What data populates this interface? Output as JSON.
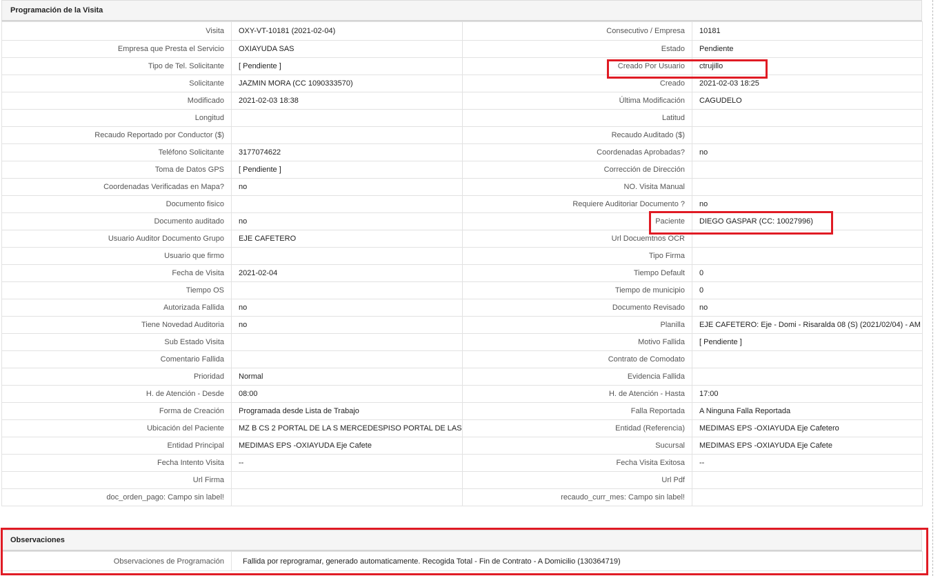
{
  "programacion": {
    "title": "Programación de la Visita",
    "rows": [
      {
        "l1": "Visita",
        "v1": "OXY-VT-10181 (2021-02-04)",
        "l2": "Consecutivo / Empresa",
        "v2": "10181"
      },
      {
        "l1": "Empresa que Presta el Servicio",
        "v1": "OXIAYUDA SAS",
        "l2": "Estado",
        "v2": "Pendiente"
      },
      {
        "l1": "Tipo de Tel. Solicitante",
        "v1": "[ Pendiente ]",
        "l2": "Creado Por Usuario",
        "v2": "ctrujillo"
      },
      {
        "l1": "Solicitante",
        "v1": "JAZMIN MORA (CC 1090333570)",
        "l2": "Creado",
        "v2": "2021-02-03 18:25"
      },
      {
        "l1": "Modificado",
        "v1": "2021-02-03 18:38",
        "l2": "Última Modificación",
        "v2": " CAGUDELO"
      },
      {
        "l1": "Longitud",
        "v1": "",
        "l2": "Latitud",
        "v2": ""
      },
      {
        "l1": "Recaudo Reportado por Conductor ($)",
        "v1": "",
        "l2": "Recaudo Auditado ($)",
        "v2": ""
      },
      {
        "l1": "Teléfono Solicitante",
        "v1": "3177074622",
        "l2": "Coordenadas Aprobadas?",
        "v2": " no"
      },
      {
        "l1": "Toma de Datos GPS",
        "v1": "[ Pendiente ]",
        "l2": "Corrección de Dirección",
        "v2": ""
      },
      {
        "l1": "Coordenadas Verificadas en Mapa?",
        "v1": " no",
        "l2": "NO. Visita Manual",
        "v2": ""
      },
      {
        "l1": "Documento fisico",
        "v1": "",
        "l2": "Requiere Auditoriar Documento ?",
        "v2": " no"
      },
      {
        "l1": "Documento auditado",
        "v1": " no",
        "l2": "Paciente",
        "v2": "DIEGO GASPAR (CC: 10027996)"
      },
      {
        "l1": "Usuario Auditor Documento Grupo",
        "v1": "EJE CAFETERO",
        "l2": "Url Docuemtnos OCR",
        "v2": ""
      },
      {
        "l1": "Usuario que firmo",
        "v1": "",
        "l2": "Tipo Firma",
        "v2": ""
      },
      {
        "l1": "Fecha de Visita",
        "v1": " 2021-02-04",
        "l2": "Tiempo Default",
        "v2": "0"
      },
      {
        "l1": "Tiempo OS",
        "v1": "",
        "l2": "Tiempo de municipio",
        "v2": "0"
      },
      {
        "l1": "Autorizada Fallida",
        "v1": " no",
        "l2": "Documento Revisado",
        "v2": " no"
      },
      {
        "l1": "Tiene Novedad Auditoria",
        "v1": " no",
        "l2": "Planilla",
        "v2": "EJE CAFETERO: Eje - Domi - Risaralda 08 (S) (2021/02/04) - AM"
      },
      {
        "l1": "Sub Estado Visita",
        "v1": "",
        "l2": "Motivo Fallida",
        "v2": "[ Pendiente ]"
      },
      {
        "l1": "Comentario Fallida",
        "v1": "",
        "l2": "Contrato de Comodato",
        "v2": ""
      },
      {
        "l1": "Prioridad",
        "v1": "Normal",
        "l2": "Evidencia Fallida",
        "v2": ""
      },
      {
        "l1": "H. de Atención - Desde",
        "v1": "08:00",
        "l2": "H. de Atención - Hasta",
        "v2": "17:00"
      },
      {
        "l1": "Forma de Creación",
        "v1": "Programada desde Lista de Trabajo",
        "l2": "Falla Reportada",
        "v2": "A Ninguna Falla Reportada"
      },
      {
        "l1": "Ubicación del Paciente",
        "v1": "MZ B CS 2 PORTAL DE LA S MERCEDESPISO PORTAL DE LAS",
        "l2": "Entidad (Referencia)",
        "v2": "MEDIMAS EPS -OXIAYUDA Eje Cafetero"
      },
      {
        "l1": "Entidad Principal",
        "v1": "MEDIMAS EPS -OXIAYUDA Eje Cafete",
        "l2": "Sucursal",
        "v2": "MEDIMAS EPS -OXIAYUDA Eje Cafete"
      },
      {
        "l1": "Fecha Intento Visita",
        "v1": "--",
        "l2": "Fecha Visita Exitosa",
        "v2": " --"
      },
      {
        "l1": "Url Firma",
        "v1": "",
        "l2": "Url Pdf",
        "v2": ""
      },
      {
        "l1": "doc_orden_pago: Campo sin label!",
        "v1": "",
        "l2": "recaudo_curr_mes: Campo sin label!",
        "v2": ""
      }
    ]
  },
  "observaciones": {
    "title": "Observaciones",
    "label": "Observaciones de Programación",
    "value": "Fallida por reprogramar, generado automaticamente. Recogida Total - Fin de Contrato - A Domicilio (130364719)"
  },
  "colors": {
    "highlight": "#e01b24",
    "header_bg": "#f5f5f5",
    "border": "#e2e2e2"
  }
}
